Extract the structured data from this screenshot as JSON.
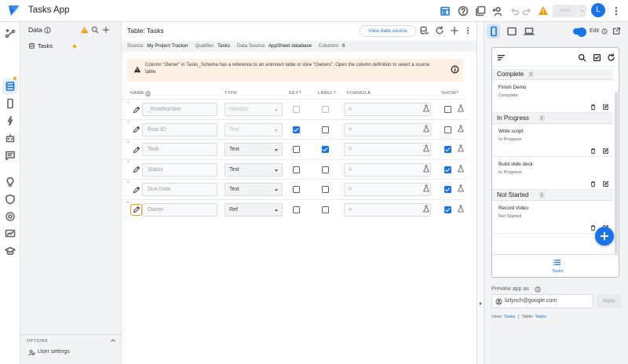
{
  "topbar": {
    "app_title": "Tasks App",
    "save_label": "SAVE",
    "avatar_initial": "L",
    "warning_color": "#f29900",
    "brand_color": "#1a73e8"
  },
  "data_panel": {
    "title": "Data",
    "tables": [
      {
        "label": "Tasks",
        "status_dot": "#f9ab00"
      }
    ],
    "options_label": "OPTIONS",
    "user_settings_label": "User settings"
  },
  "main": {
    "table_title": "Table: Tasks",
    "view_data_source_label": "View data source",
    "source_bar": {
      "source_label": "Source:",
      "source_value": "My Project Tracker",
      "qualifier_label": "Qualifier:",
      "qualifier_value": "Tasks",
      "datasource_label": "Data Source:",
      "datasource_value": "AppSheet database",
      "columns_label": "Columns:",
      "columns_value": "6"
    },
    "warning_text": "Column \"Owner\" in Tasks_Schema has a reference to an unknown table or slice \"Owners\". Open the column definition to select a source table.",
    "headers": {
      "name": "NAME",
      "type": "TYPE",
      "key": "KEY?",
      "label": "LABEL?",
      "formula": "FORMULA",
      "show": "SHOW?"
    },
    "columns": [
      {
        "num": "1",
        "name": "_RowNumber",
        "type": "Number",
        "type_disabled": true,
        "key": false,
        "key_disabled": true,
        "label": false,
        "label_disabled": true,
        "formula": "=",
        "show": false,
        "selected": false
      },
      {
        "num": "2",
        "name": "Row ID",
        "type": "Text",
        "type_disabled": true,
        "key": true,
        "key_disabled": false,
        "label": false,
        "label_disabled": false,
        "formula": "=",
        "show": false,
        "selected": false
      },
      {
        "num": "3",
        "name": "Task",
        "type": "Text",
        "type_disabled": false,
        "key": false,
        "key_disabled": false,
        "label": true,
        "label_disabled": false,
        "formula": "=",
        "show": true,
        "selected": false
      },
      {
        "num": "4",
        "name": "Status",
        "type": "Text",
        "type_disabled": false,
        "key": false,
        "key_disabled": false,
        "label": false,
        "label_disabled": false,
        "formula": "=",
        "show": true,
        "selected": false
      },
      {
        "num": "5",
        "name": "Due Date",
        "type": "Text",
        "type_disabled": false,
        "key": false,
        "key_disabled": false,
        "label": false,
        "label_disabled": false,
        "formula": "=",
        "show": true,
        "selected": false
      },
      {
        "num": "6",
        "name": "Owner",
        "type": "Ref",
        "type_disabled": false,
        "key": false,
        "key_disabled": false,
        "label": false,
        "label_disabled": false,
        "formula": "=",
        "show": true,
        "selected": true
      }
    ]
  },
  "preview": {
    "edit_label": "Edit",
    "sections": [
      {
        "label": "Complete",
        "count": "1",
        "cards": [
          {
            "title": "Finish Demo",
            "status": "Complete"
          }
        ]
      },
      {
        "label": "In Progress",
        "count": "2",
        "cards": [
          {
            "title": "Write script",
            "status": "In Progress"
          },
          {
            "title": "Build slide deck",
            "status": "In Progress"
          }
        ]
      },
      {
        "label": "Not Started",
        "count": "1",
        "cards": [
          {
            "title": "Record Video",
            "status": "Not Started"
          }
        ]
      }
    ],
    "nav_label": "Tasks",
    "preview_as_label": "Preview app as",
    "email": "lizlynch@google.com",
    "apply_label": "Apply",
    "view_label": "View:",
    "view_value": "Tasks",
    "table_label": "Table:",
    "table_value": "Tasks"
  }
}
